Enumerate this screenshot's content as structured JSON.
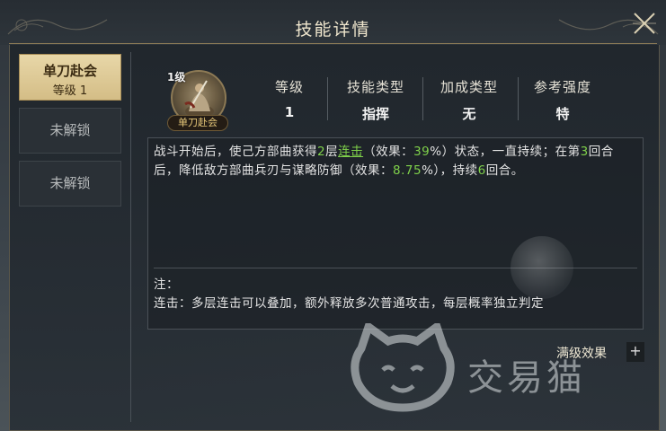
{
  "header": {
    "title": "技能详情"
  },
  "tabs": [
    {
      "line1": "单刀赴会",
      "line2": "等级 1"
    },
    {
      "label": "未解锁"
    },
    {
      "label": "未解锁"
    }
  ],
  "skill": {
    "level_tag": "1级",
    "name": "单刀赴会",
    "stats": [
      {
        "header": "等级",
        "value": "1"
      },
      {
        "header": "技能类型",
        "value": "指挥"
      },
      {
        "header": "加成类型",
        "value": "无"
      },
      {
        "header": "参考强度",
        "value": "特"
      }
    ],
    "desc": {
      "p1": "战斗开始后，使己方部曲获得",
      "n1": "2",
      "p2": "层",
      "link": "连击",
      "p3": "（效果：",
      "n2": "39",
      "p4": "%）状态，一直持续；在第",
      "n3": "3",
      "p5": "回合后，降低敌方部曲兵刃与谋略防御（效果：",
      "n4": "8.75",
      "p6": "%），持续",
      "n5": "6",
      "p7": "回合。"
    },
    "note_title": "注：",
    "note_body": "连击：多层连击可以叠加，额外释放多次普通攻击，每层概率独立判定"
  },
  "footer": {
    "full_effect_label": "满级效果",
    "plus_label": "+"
  },
  "watermark": {
    "text": "交易猫"
  },
  "colors": {
    "highlight": "#7fd14a",
    "title": "#efe6cd",
    "tab_active": "#e8d7a8"
  }
}
